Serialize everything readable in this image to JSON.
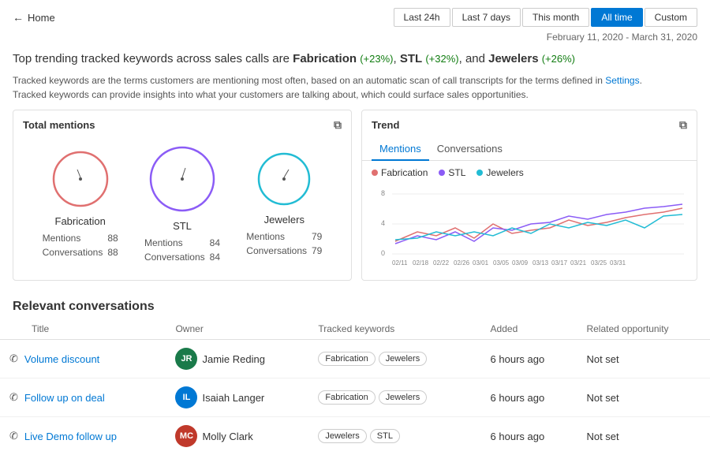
{
  "header": {
    "back_label": "Home",
    "time_filters": [
      {
        "id": "last24h",
        "label": "Last 24h",
        "active": false
      },
      {
        "id": "last7d",
        "label": "Last 7 days",
        "active": false
      },
      {
        "id": "thismonth",
        "label": "This month",
        "active": false
      },
      {
        "id": "alltime",
        "label": "All time",
        "active": true
      },
      {
        "id": "custom",
        "label": "Custom",
        "active": false
      }
    ]
  },
  "date_range": "February 11, 2020 - March 31, 2020",
  "headline": {
    "prefix": "Top trending tracked keywords across sales calls are ",
    "kw1": "Fabrication",
    "kw1_change": "(+23%)",
    "sep1": ", ",
    "kw2": "STL",
    "kw2_change": "(+32%)",
    "sep2": ", and ",
    "kw3": "Jewelers",
    "kw3_change": "(+26%)"
  },
  "description": {
    "line1": "Tracked keywords are the terms customers are mentioning most often, based on an automatic scan of call transcripts for the terms defined in Settings.",
    "line2": "Tracked keywords can provide insights into what your customers are talking about, which could surface sales opportunities."
  },
  "total_mentions": {
    "panel_title": "Total mentions",
    "items": [
      {
        "name": "Fabrication",
        "mentions": 88,
        "conversations": 88,
        "circle_color": "#e07070",
        "radius": 38
      },
      {
        "name": "STL",
        "mentions": 84,
        "conversations": 84,
        "circle_color": "#8b5cf6",
        "radius": 44
      },
      {
        "name": "Jewelers",
        "mentions": 79,
        "conversations": 79,
        "circle_color": "#22bcd4",
        "radius": 36
      }
    ],
    "stat_labels": {
      "mentions": "Mentions",
      "conversations": "Conversations"
    }
  },
  "trend": {
    "panel_title": "Trend",
    "tabs": [
      "Mentions",
      "Conversations"
    ],
    "active_tab": "Mentions",
    "legend": [
      {
        "label": "Fabrication",
        "color": "#e07070"
      },
      {
        "label": "STL",
        "color": "#8b5cf6"
      },
      {
        "label": "Jewelers",
        "color": "#22bcd4"
      }
    ],
    "x_labels": [
      "02/11",
      "02/18",
      "02/22",
      "02/26",
      "03/01",
      "03/05",
      "03/09",
      "03/13",
      "03/17",
      "03/21",
      "03/25",
      "03/31"
    ],
    "y_labels": [
      "8",
      "4",
      "0"
    ],
    "y_max": 10
  },
  "conversations": {
    "section_title": "Relevant conversations",
    "columns": [
      "Title",
      "Owner",
      "Tracked keywords",
      "Added",
      "Related opportunity"
    ],
    "rows": [
      {
        "title": "Volume discount",
        "owner_name": "Jamie Reding",
        "owner_initials": "JR",
        "owner_color": "#1a7a4a",
        "keywords": [
          "Fabrication",
          "Jewelers"
        ],
        "added": "6 hours ago",
        "opportunity": "Not set"
      },
      {
        "title": "Follow up on deal",
        "owner_name": "Isaiah Langer",
        "owner_initials": "IL",
        "owner_color": "#0078d4",
        "keywords": [
          "Fabrication",
          "Jewelers"
        ],
        "added": "6 hours ago",
        "opportunity": "Not set"
      },
      {
        "title": "Live Demo follow up",
        "owner_name": "Molly Clark",
        "owner_initials": "MC",
        "owner_color": "#c0392b",
        "keywords": [
          "Jewelers",
          "STL"
        ],
        "added": "6 hours ago",
        "opportunity": "Not set"
      }
    ]
  },
  "icons": {
    "back_arrow": "←",
    "copy": "⧉",
    "phone": "✆"
  }
}
